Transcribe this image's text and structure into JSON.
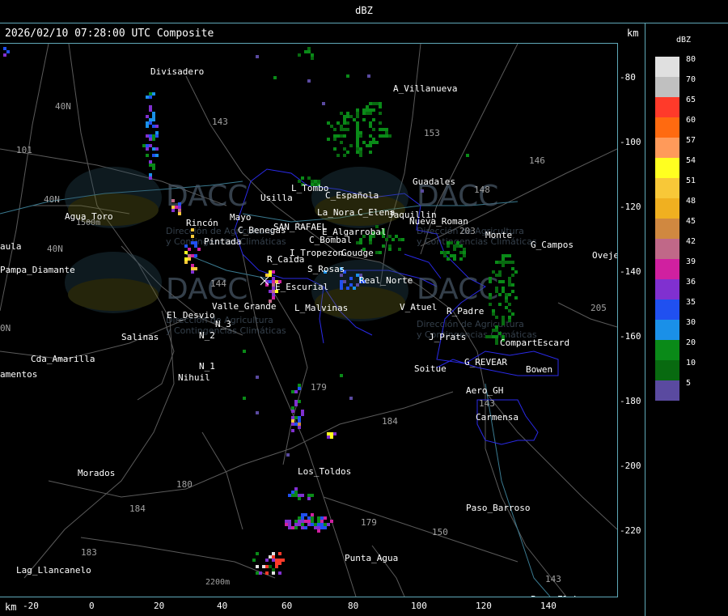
{
  "window": {
    "title": "dBZ"
  },
  "header": {
    "timestamp": "2026/02/10 07:28:00 UTC Composite",
    "y_unit": "km",
    "x_unit": "km"
  },
  "legend": {
    "title": "dBZ",
    "items": [
      {
        "value": "80",
        "color": "#e0e0e0"
      },
      {
        "value": "70",
        "color": "#c0c0c0"
      },
      {
        "value": "65",
        "color": "#ff3a2a"
      },
      {
        "value": "60",
        "color": "#ff6a10"
      },
      {
        "value": "57",
        "color": "#ff9a5a"
      },
      {
        "value": "54",
        "color": "#ffff20"
      },
      {
        "value": "51",
        "color": "#f8c838"
      },
      {
        "value": "48",
        "color": "#f0b020"
      },
      {
        "value": "45",
        "color": "#d08840"
      },
      {
        "value": "42",
        "color": "#c06888"
      },
      {
        "value": "39",
        "color": "#d020a0"
      },
      {
        "value": "36",
        "color": "#8030d0"
      },
      {
        "value": "35",
        "color": "#2050f0"
      },
      {
        "value": "30",
        "color": "#1a90e8"
      },
      {
        "value": "20",
        "color": "#0a8a18"
      },
      {
        "value": "10",
        "color": "#086a10"
      },
      {
        "value": "5",
        "color": "#5a4aa0"
      }
    ]
  },
  "axes": {
    "x_ticks": [
      "-20",
      "0",
      "20",
      "40",
      "60",
      "80",
      "100",
      "120",
      "140"
    ],
    "y_ticks": [
      "-80",
      "-100",
      "-120",
      "-140",
      "-160",
      "-180",
      "-200",
      "-220"
    ]
  },
  "places": [
    "Divisadero",
    "A_Villanueva",
    "Guadales",
    "Usilla",
    "L_Tombo",
    "C_Española",
    "La_Nora",
    "C_Elena",
    "Jaquillin",
    "C_Benegas",
    "SAN_RAFAEL",
    "E_Algarrobal",
    "C_Bombal",
    "Nueva_Roman",
    "G_Campos",
    "Oveje",
    "Pintada",
    "Rincón",
    "Mayo",
    "I_Tropezon",
    "Goudge",
    "R_Caida",
    "S_Rosas",
    "Real_Norte",
    "E_Escurial",
    "Valle_Grande",
    "L_Malvinas",
    "V_Atuel",
    "R_Padre",
    "El_Desvio",
    "N_3",
    "N_2",
    "N_1",
    "Salinas",
    "Cda_Amarilla",
    "Nihuil",
    "Soitue",
    "Aero_GH",
    "G_REVEAR",
    "Bowen",
    "CompartEscard",
    "J_Prats",
    "Carmensa",
    "Los_Toldos",
    "Morados",
    "Paso_Barroso",
    "Punta_Agua",
    "Lag_Llancanelo",
    "Paso_El_Loro",
    "Agua_Toro",
    "Pampa_Diamante",
    "aula",
    "amentos",
    "Monte"
  ],
  "route_numbers": [
    "143",
    "153",
    "146",
    "148",
    "203",
    "205",
    "143",
    "144",
    "179",
    "184",
    "180",
    "184",
    "183",
    "179",
    "150",
    "143",
    "101",
    "40N",
    "40N",
    "40N",
    "0N"
  ],
  "terrain_labels": [
    "1500m",
    "2200m"
  ],
  "watermark": {
    "brand": "DACC",
    "line1": "Dirección de Agricultura",
    "line2": "y Contingencias Climáticas"
  },
  "colors": {
    "frame": "#5fa8b8",
    "roads": "#606060",
    "boundaries": "#2a2ae8",
    "labels": "#ffffff",
    "route_numbers": "#a0a0a0"
  }
}
